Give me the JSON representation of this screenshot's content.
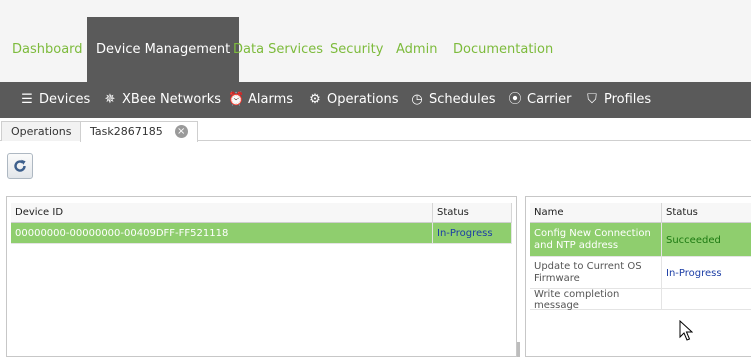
{
  "top_nav": [
    {
      "label": "Dashboard",
      "active": false
    },
    {
      "label": "Device Management",
      "active": true
    },
    {
      "label": "Data Services",
      "active": false
    },
    {
      "label": "Security",
      "active": false
    },
    {
      "label": "Admin",
      "active": false
    },
    {
      "label": "Documentation",
      "active": false
    }
  ],
  "sub_nav": [
    {
      "label": "Devices",
      "icon": "devices-icon",
      "glyph": "☰"
    },
    {
      "label": "XBee Networks",
      "icon": "xbee-network-icon",
      "glyph": "✵"
    },
    {
      "label": "Alarms",
      "icon": "alarm-clock-icon",
      "glyph": "⏰"
    },
    {
      "label": "Operations",
      "icon": "gear-icon",
      "glyph": "⚙"
    },
    {
      "label": "Schedules",
      "icon": "clock-icon",
      "glyph": "◷"
    },
    {
      "label": "Carrier",
      "icon": "signal-icon",
      "glyph": "⦿"
    },
    {
      "label": "Profiles",
      "icon": "shield-icon",
      "glyph": "⛉"
    }
  ],
  "tabs": [
    {
      "label": "Operations"
    },
    {
      "label": "Task2867185"
    }
  ],
  "devices_grid": {
    "headers": [
      "Device ID",
      "Status"
    ],
    "rows": [
      {
        "device_id": "00000000-00000000-00409DFF-FF521118",
        "status": "In-Progress"
      }
    ]
  },
  "tasks_grid": {
    "headers": [
      "Name",
      "Status"
    ],
    "rows": [
      {
        "name_line1": "Config New Connection",
        "name_line2": "and NTP address",
        "status": "Succeeded"
      },
      {
        "name_line1": "Update to Current OS",
        "name_line2": "Firmware",
        "status": "In-Progress"
      },
      {
        "name_line1": "Write completion message",
        "name_line2": "",
        "status": ""
      }
    ]
  }
}
